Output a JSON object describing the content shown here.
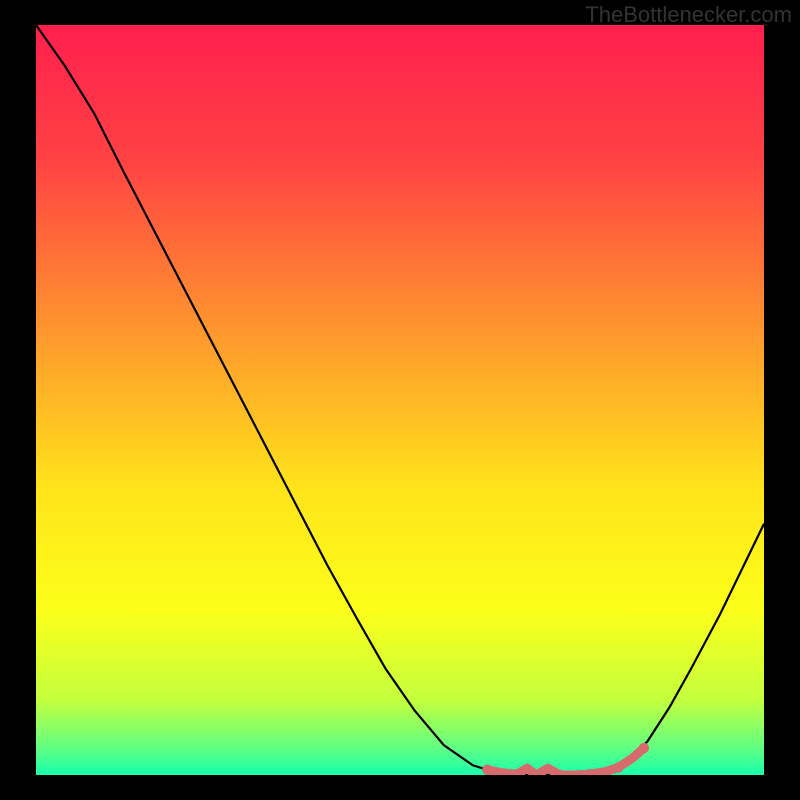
{
  "watermark": "TheBottlenecker.com",
  "chart_data": {
    "type": "line",
    "title": "",
    "xlabel": "",
    "ylabel": "",
    "xlim": [
      0,
      100
    ],
    "ylim": [
      0,
      100
    ],
    "grid": false,
    "legend": false,
    "gradient": {
      "stops": [
        {
          "pct": 0,
          "color": "#ff1f4e"
        },
        {
          "pct": 18,
          "color": "#ff4243"
        },
        {
          "pct": 45,
          "color": "#ffa62a"
        },
        {
          "pct": 62,
          "color": "#ffe41a"
        },
        {
          "pct": 78,
          "color": "#fcff1a"
        },
        {
          "pct": 90,
          "color": "#c3ff3d"
        },
        {
          "pct": 96,
          "color": "#67ff7d"
        },
        {
          "pct": 100,
          "color": "#19ffad"
        }
      ]
    },
    "series": [
      {
        "name": "curve",
        "stroke": "#000000",
        "x": [
          0,
          4,
          8,
          12,
          16,
          20,
          24,
          28,
          32,
          36,
          40,
          44,
          48,
          52,
          56,
          60,
          63,
          66,
          69,
          72,
          75,
          78,
          81,
          84,
          87,
          90,
          94,
          97,
          100
        ],
        "y": [
          100,
          94.5,
          88.2,
          80.5,
          73.0,
          65.5,
          58.0,
          50.5,
          43.0,
          35.5,
          28.0,
          21.0,
          14.2,
          8.6,
          4.0,
          1.3,
          0.4,
          0.1,
          0.0,
          0.0,
          0.1,
          0.3,
          1.5,
          4.5,
          9.0,
          14.2,
          21.5,
          27.5,
          33.5
        ]
      },
      {
        "name": "marker-band",
        "stroke": "#d76a6c",
        "x": [
          62,
          64,
          66,
          67.5,
          68.7,
          70.3,
          72,
          74,
          76,
          78,
          80,
          82,
          83.5
        ],
        "y": [
          0.7,
          0.3,
          0.1,
          0.9,
          0.0,
          0.9,
          0.0,
          0.0,
          0.1,
          0.4,
          1.0,
          2.3,
          3.6
        ]
      }
    ]
  }
}
